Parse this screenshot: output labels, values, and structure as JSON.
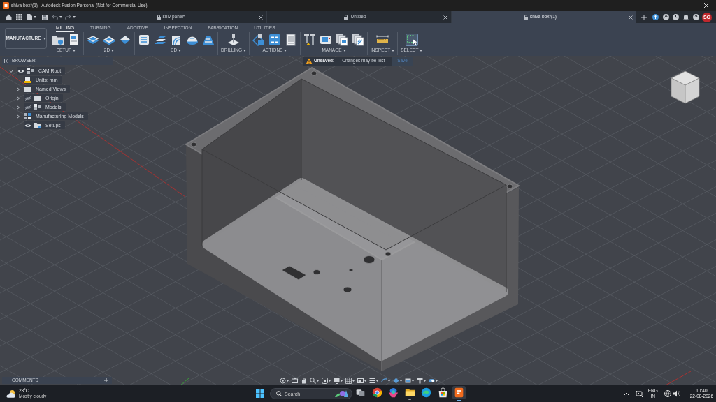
{
  "window": {
    "title": "shiva box*(1) - Autodesk Fusion Personal (Not for Commercial Use)"
  },
  "document_tabs": [
    {
      "label": "shiv panel*",
      "selected": false
    },
    {
      "label": "Untitled",
      "selected": false
    },
    {
      "label": "shiva box*(1)",
      "selected": true
    }
  ],
  "account": {
    "initials": "SG"
  },
  "workspace": {
    "label": "MANUFACTURE"
  },
  "ribbon_tabs": [
    {
      "label": "MILLING",
      "selected": true
    },
    {
      "label": "TURNING",
      "selected": false
    },
    {
      "label": "ADDITIVE",
      "selected": false
    },
    {
      "label": "INSPECTION",
      "selected": false
    },
    {
      "label": "FABRICATION",
      "selected": false
    },
    {
      "label": "UTILITIES",
      "selected": false
    }
  ],
  "ribbon_groups": [
    {
      "label": "SETUP",
      "active": false
    },
    {
      "label": "2D",
      "active": false
    },
    {
      "label": "3D",
      "active": false
    },
    {
      "label": "DRILLING",
      "active": false
    },
    {
      "label": "ACTIONS",
      "active": false
    },
    {
      "label": "MANAGE",
      "active": false
    },
    {
      "label": "INSPECT",
      "active": false
    },
    {
      "label": "SELECT",
      "active": true
    }
  ],
  "browser": {
    "title": "BROWSER",
    "items": [
      {
        "label": "CAM Root",
        "kind": "component",
        "expanded": true,
        "visible": true,
        "children": [
          {
            "label": "Units: mm",
            "kind": "units"
          },
          {
            "label": "Named Views",
            "kind": "folder",
            "expanded": false
          },
          {
            "label": "Origin",
            "kind": "folder",
            "expanded": false,
            "visible": false
          },
          {
            "label": "Models",
            "kind": "component",
            "expanded": false,
            "visible": false
          },
          {
            "label": "Manufacturing Models",
            "kind": "manufacturing-model",
            "expanded": false
          },
          {
            "label": "Setups",
            "kind": "setups",
            "visible": true
          }
        ]
      }
    ]
  },
  "notice": {
    "label": "Unsaved:",
    "message": "Changes may be lost",
    "action": "Save"
  },
  "comments": {
    "title": "COMMENTS"
  },
  "taskbar": {
    "weather": {
      "temperature": "23°C",
      "condition": "Mostly cloudy"
    },
    "search": {
      "placeholder": "Search"
    },
    "apps": [
      {
        "kind": "task-view",
        "running": false,
        "selected": false
      },
      {
        "kind": "browser",
        "running": false,
        "selected": false
      },
      {
        "kind": "office",
        "running": false,
        "selected": false
      },
      {
        "kind": "files",
        "running": true,
        "selected": false
      },
      {
        "kind": "web",
        "running": false,
        "selected": false
      },
      {
        "kind": "store",
        "running": false,
        "selected": false
      },
      {
        "kind": "cad",
        "running": true,
        "selected": true
      }
    ],
    "language": "ENG",
    "region": "IN",
    "time": "10:40",
    "date": "22-08-2026"
  }
}
